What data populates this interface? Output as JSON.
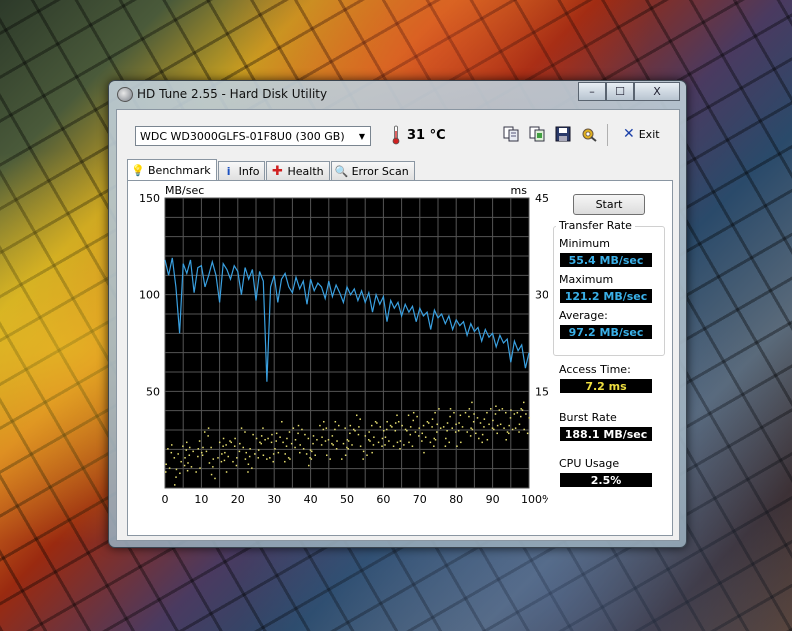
{
  "window": {
    "title": "HD Tune 2.55 - Hard Disk Utility",
    "min_label": "–",
    "max_label": "☐",
    "close_label": "X"
  },
  "toolbar": {
    "drive": "WDC WD3000GLFS-01F8U0 (300 GB)",
    "temperature": "31 °C",
    "icons": [
      "copy-icon",
      "copy-info-icon",
      "save-icon",
      "options-icon"
    ],
    "exit_label": "Exit"
  },
  "tabs": [
    {
      "label": "Benchmark",
      "icon": "lightbulb-icon",
      "active": true
    },
    {
      "label": "Info",
      "icon": "info-icon",
      "active": false
    },
    {
      "label": "Health",
      "icon": "health-cross-icon",
      "active": false
    },
    {
      "label": "Error Scan",
      "icon": "magnifier-icon",
      "active": false
    }
  ],
  "benchmark": {
    "start_label": "Start",
    "transfer_rate_title": "Transfer Rate",
    "minimum_label": "Minimum",
    "minimum_value": "55.4 MB/sec",
    "maximum_label": "Maximum",
    "maximum_value": "121.2 MB/sec",
    "average_label": "Average:",
    "average_value": "97.2 MB/sec",
    "access_label": "Access Time:",
    "access_value": "7.2 ms",
    "burst_label": "Burst Rate",
    "burst_value": "188.1 MB/sec",
    "cpu_label": "CPU Usage",
    "cpu_value": "2.5%"
  },
  "chart_data": {
    "type": "line",
    "left_unit": "MB/sec",
    "right_unit": "ms",
    "left_ylim": [
      0,
      150
    ],
    "right_ylim": [
      0,
      45
    ],
    "left_ticks": [
      "150",
      "100",
      "50"
    ],
    "right_ticks": [
      "45",
      "30",
      "15"
    ],
    "xlim": [
      0,
      100
    ],
    "x_ticks": [
      "0",
      "10",
      "20",
      "30",
      "40",
      "50",
      "60",
      "70",
      "80",
      "90",
      "100%"
    ],
    "grid": true,
    "series": [
      {
        "color": "#3aa0e0",
        "x": [
          0,
          1,
          2,
          3,
          4,
          5,
          6,
          7,
          8,
          9,
          10,
          11,
          12,
          13,
          14,
          15,
          16,
          17,
          18,
          19,
          20,
          21,
          22,
          23,
          24,
          25,
          26,
          27,
          28,
          29,
          30,
          31,
          32,
          33,
          34,
          35,
          36,
          37,
          38,
          39,
          40,
          41,
          42,
          43,
          44,
          45,
          46,
          47,
          48,
          49,
          50,
          51,
          52,
          53,
          54,
          55,
          56,
          57,
          58,
          59,
          60,
          61,
          62,
          63,
          64,
          65,
          66,
          67,
          68,
          69,
          70,
          71,
          72,
          73,
          74,
          75,
          76,
          77,
          78,
          79,
          80,
          81,
          82,
          83,
          84,
          85,
          86,
          87,
          88,
          89,
          90,
          91,
          92,
          93,
          94,
          95,
          96,
          97,
          98,
          99,
          100
        ],
        "y": [
          118,
          110,
          119,
          104,
          80,
          116,
          111,
          118,
          101,
          114,
          115,
          104,
          110,
          117,
          110,
          96,
          116,
          113,
          108,
          115,
          112,
          100,
          114,
          108,
          113,
          97,
          112,
          107,
          55,
          104,
          110,
          96,
          108,
          111,
          104,
          101,
          109,
          103,
          107,
          95,
          108,
          102,
          106,
          104,
          98,
          107,
          99,
          105,
          101,
          96,
          104,
          100,
          103,
          97,
          102,
          96,
          101,
          91,
          100,
          95,
          99,
          86,
          97,
          93,
          96,
          89,
          95,
          91,
          94,
          86,
          93,
          89,
          91,
          82,
          92,
          88,
          90,
          85,
          89,
          82,
          87,
          84,
          86,
          79,
          85,
          81,
          83,
          76,
          82,
          78,
          80,
          73,
          79,
          75,
          77,
          65,
          76,
          71,
          74,
          62,
          70
        ]
      }
    ],
    "access_points_note_free": true,
    "access_x": [
      0,
      2,
      4,
      6,
      8,
      10,
      12,
      14,
      16,
      18,
      20,
      22,
      24,
      26,
      28,
      30,
      32,
      34,
      36,
      38,
      40,
      42,
      44,
      46,
      48,
      50,
      52,
      54,
      56,
      58,
      60,
      62,
      64,
      66,
      68,
      70,
      72,
      74,
      76,
      78,
      80,
      82,
      84,
      86,
      88,
      90,
      92,
      94,
      96,
      98,
      100
    ],
    "access_y": [
      5,
      3,
      6,
      4,
      5,
      7,
      4,
      6,
      5,
      6,
      7,
      5,
      6,
      7,
      6,
      8,
      6,
      7,
      8,
      6,
      7,
      8,
      7,
      8,
      7,
      8,
      9,
      7,
      8,
      9,
      8,
      9,
      8,
      9,
      10,
      8,
      9,
      10,
      9,
      10,
      9,
      10,
      11,
      9,
      10,
      11,
      10,
      11,
      10,
      11,
      10
    ]
  }
}
